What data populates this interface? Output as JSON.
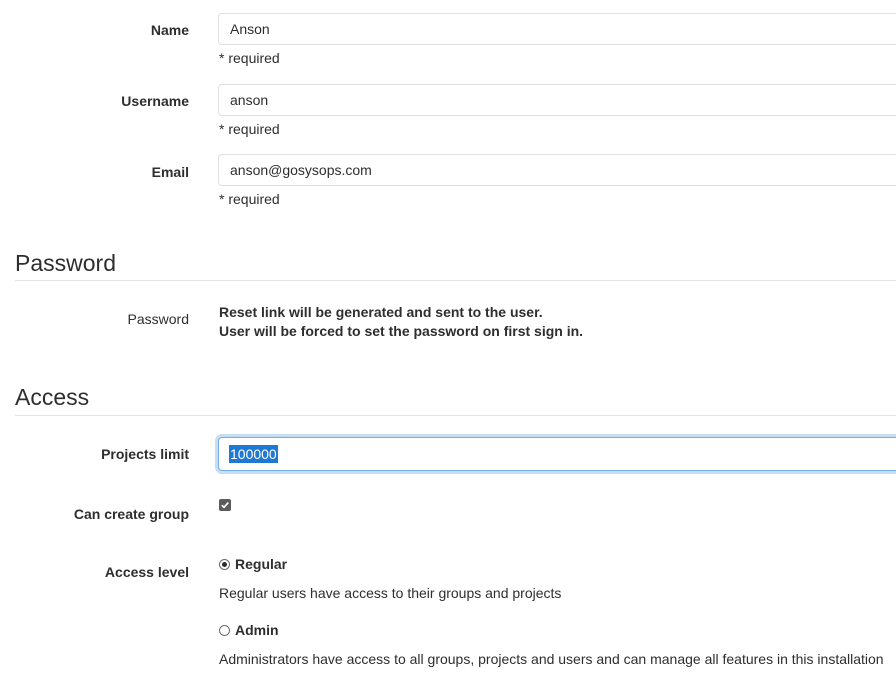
{
  "account": {
    "name": {
      "label": "Name",
      "value": "Anson",
      "hint": "* required"
    },
    "username": {
      "label": "Username",
      "value": "anson",
      "hint": "* required"
    },
    "email": {
      "label": "Email",
      "value": "anson@gosysops.com",
      "hint": "* required"
    }
  },
  "password_section": {
    "title": "Password",
    "label": "Password",
    "line1": "Reset link will be generated and sent to the user.",
    "line2": "User will be forced to set the password on first sign in."
  },
  "access_section": {
    "title": "Access",
    "projects_limit": {
      "label": "Projects limit",
      "value": "100000"
    },
    "can_create_group": {
      "label": "Can create group",
      "checked": true
    },
    "access_level": {
      "label": "Access level",
      "options": [
        {
          "label": "Regular",
          "description": "Regular users have access to their groups and projects",
          "selected": true
        },
        {
          "label": "Admin",
          "description": "Administrators have access to all groups, projects and users and can manage all features in this installation",
          "selected": false
        }
      ]
    }
  },
  "colors": {
    "accent": "#1f78d1",
    "focus_border": "#73afea",
    "border": "#dfdfdf",
    "text": "#2e2e2e"
  }
}
